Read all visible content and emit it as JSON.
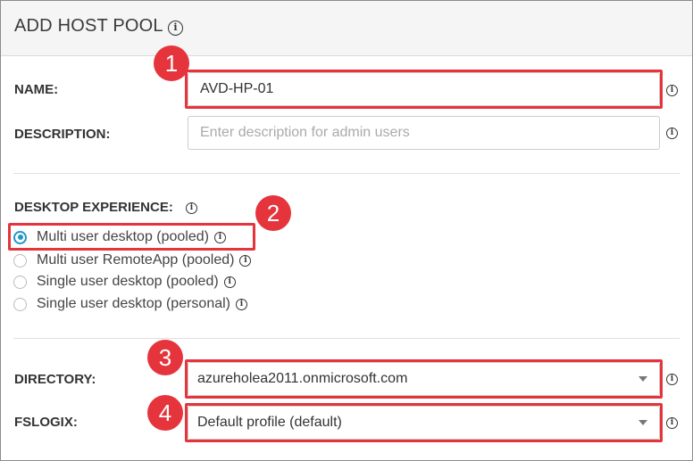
{
  "header": {
    "title": "ADD HOST POOL",
    "info_icon": "info-icon"
  },
  "name": {
    "label": "NAME:",
    "value": "AVD-HP-01"
  },
  "description": {
    "label": "DESCRIPTION:",
    "placeholder": "Enter description for admin users"
  },
  "desktop_experience": {
    "label": "DESKTOP EXPERIENCE:",
    "options": [
      {
        "label": "Multi user desktop (pooled)",
        "selected": true
      },
      {
        "label": "Multi user RemoteApp (pooled)",
        "selected": false
      },
      {
        "label": "Single user desktop (pooled)",
        "selected": false
      },
      {
        "label": "Single user desktop (personal)",
        "selected": false
      }
    ]
  },
  "directory": {
    "label": "DIRECTORY:",
    "value": "azureholea2011.onmicrosoft.com"
  },
  "fslogix": {
    "label": "FSLOGIX:",
    "value": "Default profile (default)"
  },
  "callouts": [
    "1",
    "2",
    "3",
    "4"
  ],
  "colors": {
    "callout": "#e5343c",
    "radio_selected": "#1f97c9"
  }
}
